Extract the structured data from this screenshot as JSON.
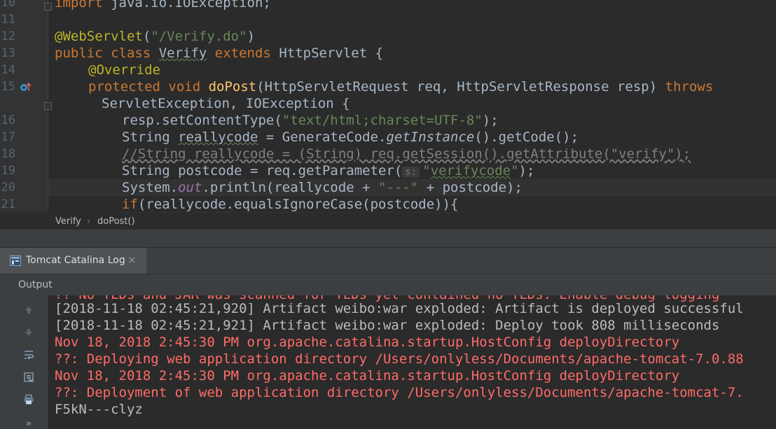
{
  "editor": {
    "line_numbers": [
      "10",
      "11",
      "12",
      "13",
      "14",
      "15",
      "",
      "16",
      "17",
      "18",
      "19",
      "20",
      "21"
    ],
    "lines": {
      "l10": {
        "kw": "import",
        "rest": " java.io.IOException;"
      },
      "l12": {
        "ann": "@WebServlet",
        "p1": "(",
        "str": "\"/Verify.do\"",
        "p2": ")"
      },
      "l13": {
        "kw1": "public class ",
        "cls": "Verify",
        "kw2": " extends ",
        "rest": "HttpServlet {"
      },
      "l14": {
        "ann": "@Override"
      },
      "l15": {
        "kw": "protected void ",
        "fn": "doPost",
        "rest": "(HttpServletRequest req, HttpServletResponse resp) ",
        "kw2": "throws"
      },
      "l15b": {
        "rest": "ServletException, IOException {"
      },
      "l16": {
        "a": "resp.setContentType(",
        "str": "\"text/html;charset=UTF-8\"",
        "b": ");"
      },
      "l17": {
        "a": "String ",
        "var": "reallycode",
        "b": " = GenerateCode.",
        "it": "getInstance",
        "c": "().getCode();"
      },
      "l18": {
        "cm": "//String reallycode = (String) req.getSession().getAttribute(\"verify\");"
      },
      "l19": {
        "a": "String postcode = req.getParameter(",
        "hint": "s:",
        "str1": "\"",
        "strv": "verifycode",
        "str2": "\"",
        "b": ");"
      },
      "l20": {
        "a": "System.",
        "fld": "out",
        "b": ".println(reallycode + ",
        "str": "\"---\"",
        "c": " + postcode);"
      },
      "l21": {
        "kw": "if",
        "rest": "(reallycode.equalsIgnoreCase(postcode)){"
      }
    }
  },
  "breadcrumb": {
    "class": "Verify",
    "sep": "›",
    "method": "doPost()"
  },
  "toolwindow": {
    "tab_label": "Tomcat Catalina Log",
    "close": "✕",
    "output_label": "Output"
  },
  "console": {
    "lines": [
      {
        "text": "?? No TLDs and JAR was scanned for TLDs yet contained no TLDs. Enable debug logging",
        "color": "red"
      },
      {
        "text": "[2018-11-18 02:45:21,920] Artifact weibo:war exploded: Artifact is deployed successful",
        "color": "white"
      },
      {
        "text": "[2018-11-18 02:45:21,921] Artifact weibo:war exploded: Deploy took 808 milliseconds",
        "color": "white"
      },
      {
        "text": "Nov 18, 2018 2:45:30 PM org.apache.catalina.startup.HostConfig deployDirectory",
        "color": "red"
      },
      {
        "text": "??: Deploying web application directory /Users/onlyless/Documents/apache-tomcat-7.0.88",
        "color": "red"
      },
      {
        "text": "Nov 18, 2018 2:45:30 PM org.apache.catalina.startup.HostConfig deployDirectory",
        "color": "red"
      },
      {
        "text": "??: Deployment of web application directory /Users/onlyless/Documents/apache-tomcat-7.",
        "color": "red"
      },
      {
        "text": "F5kN---clyz",
        "color": "white"
      }
    ],
    "more": "»"
  },
  "colors": {
    "keyword": "#cc7832",
    "annotation": "#bbb529",
    "string": "#6a8759",
    "error": "#ff6b68"
  }
}
